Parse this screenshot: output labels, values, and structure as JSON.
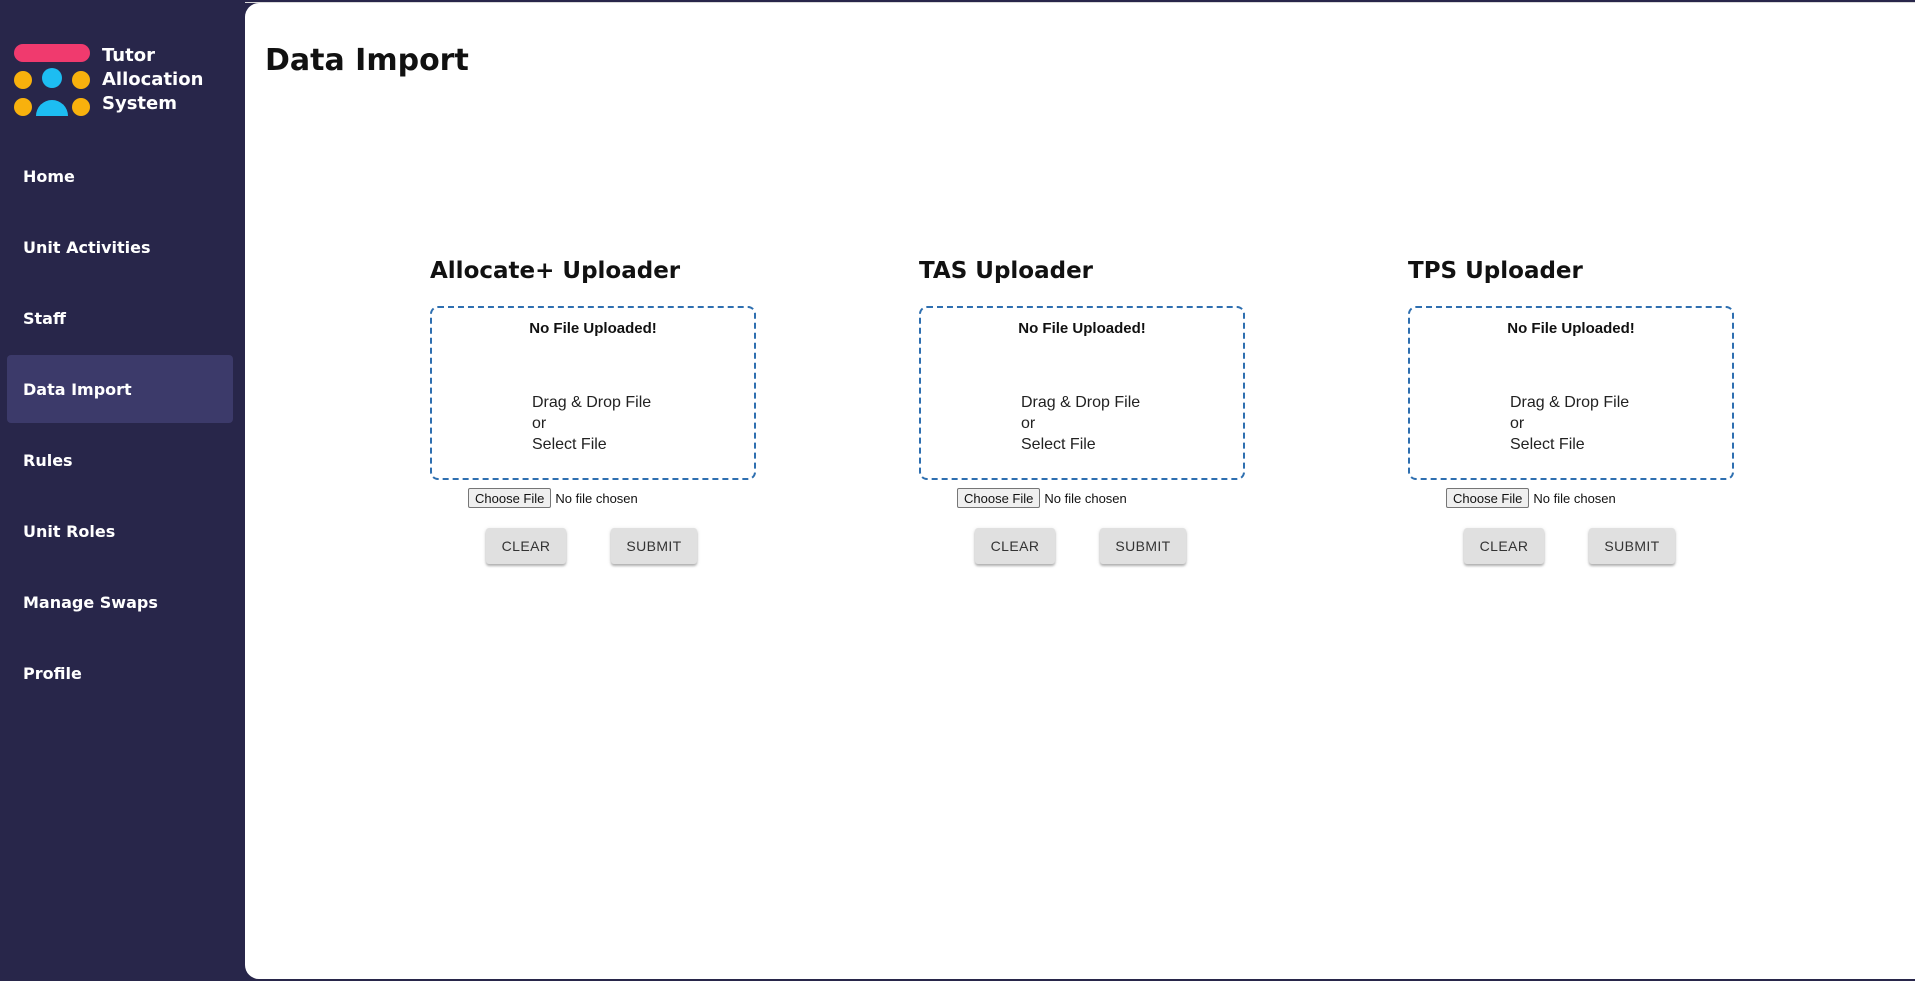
{
  "app": {
    "logo_lines": [
      "Tutor",
      "Allocation",
      "System"
    ],
    "colors": {
      "sidebar": "#28264a",
      "active_item": "#3c3a6a",
      "logo_pink": "#f03a6e",
      "logo_yellow": "#f8b10d",
      "logo_blue": "#1dbdf2",
      "dropzone_border": "#2e6fb0"
    }
  },
  "sidebar": {
    "items": [
      {
        "label": "Home",
        "active": false
      },
      {
        "label": "Unit Activities",
        "active": false
      },
      {
        "label": "Staff",
        "active": false
      },
      {
        "label": "Data Import",
        "active": true
      },
      {
        "label": "Rules",
        "active": false
      },
      {
        "label": "Unit Roles",
        "active": false
      },
      {
        "label": "Manage Swaps",
        "active": false
      },
      {
        "label": "Profile",
        "active": false
      }
    ]
  },
  "main": {
    "title": "Data Import",
    "uploaders": [
      {
        "title": "Allocate+ Uploader",
        "status": "No File Uploaded!",
        "instructions": [
          "Drag & Drop File",
          "or",
          "Select File"
        ],
        "choose_label": "Choose File",
        "file_status": "No file chosen",
        "clear_label": "CLEAR",
        "submit_label": "SUBMIT"
      },
      {
        "title": "TAS Uploader",
        "status": "No File Uploaded!",
        "instructions": [
          "Drag & Drop File",
          "or",
          "Select File"
        ],
        "choose_label": "Choose File",
        "file_status": "No file chosen",
        "clear_label": "CLEAR",
        "submit_label": "SUBMIT"
      },
      {
        "title": "TPS Uploader",
        "status": "No File Uploaded!",
        "instructions": [
          "Drag & Drop File",
          "or",
          "Select File"
        ],
        "choose_label": "Choose File",
        "file_status": "No file chosen",
        "clear_label": "CLEAR",
        "submit_label": "SUBMIT"
      }
    ]
  }
}
